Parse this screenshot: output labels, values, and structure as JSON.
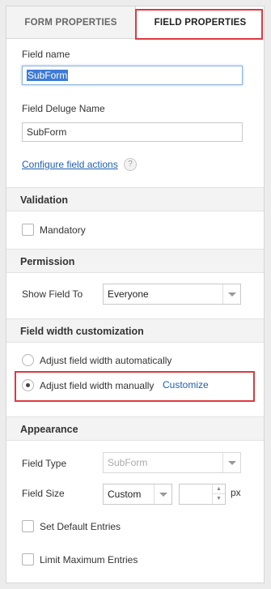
{
  "tabs": {
    "form": "FORM PROPERTIES",
    "field": "FIELD PROPERTIES"
  },
  "field_name": {
    "label": "Field name",
    "value": "SubForm"
  },
  "deluge_name": {
    "label": "Field Deluge Name",
    "value": "SubForm"
  },
  "configure_link": "Configure field actions",
  "help_glyph": "?",
  "validation": {
    "title": "Validation",
    "mandatory": "Mandatory"
  },
  "permission": {
    "title": "Permission",
    "show_label": "Show Field To",
    "show_value": "Everyone"
  },
  "width": {
    "title": "Field width customization",
    "auto_label": "Adjust field width automatically",
    "manual_label": "Adjust field width manually",
    "customize": "Customize"
  },
  "appearance": {
    "title": "Appearance",
    "type_label": "Field Type",
    "type_value": "SubForm",
    "size_label": "Field Size",
    "size_value": "Custom",
    "unit": "px",
    "default_entries": "Set Default Entries",
    "limit_entries": "Limit Maximum Entries"
  },
  "colors": {
    "highlight": "#e0383f",
    "link": "#1f5fb2"
  }
}
